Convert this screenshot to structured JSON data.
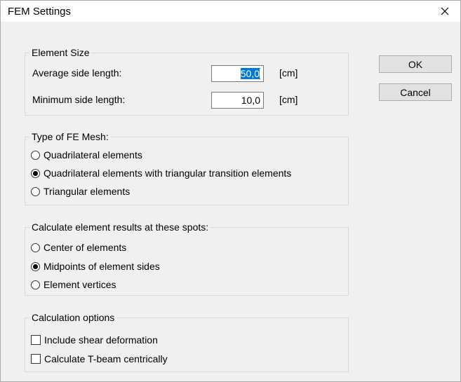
{
  "window": {
    "title": "FEM Settings"
  },
  "element_size": {
    "legend": "Element Size",
    "avg_label": "Average side length:",
    "avg_value": "50,0",
    "avg_unit": "[cm]",
    "min_label": "Minimum side length:",
    "min_value": "10,0",
    "min_unit": "[cm]"
  },
  "mesh_type": {
    "legend": "Type of FE Mesh:",
    "options": [
      {
        "label": "Quadrilateral elements",
        "selected": false
      },
      {
        "label": "Quadrilateral elements with triangular transition elements",
        "selected": true
      },
      {
        "label": "Triangular elements",
        "selected": false
      }
    ]
  },
  "spots": {
    "legend": "Calculate element results at these spots:",
    "options": [
      {
        "label": "Center of elements",
        "selected": false
      },
      {
        "label": "Midpoints of element sides",
        "selected": true
      },
      {
        "label": "Element vertices",
        "selected": false
      }
    ]
  },
  "calc_options": {
    "legend": "Calculation options",
    "items": [
      {
        "label": "Include shear deformation",
        "checked": false
      },
      {
        "label": "Calculate T-beam centrically",
        "checked": false
      }
    ]
  },
  "buttons": {
    "ok": "OK",
    "cancel": "Cancel"
  }
}
